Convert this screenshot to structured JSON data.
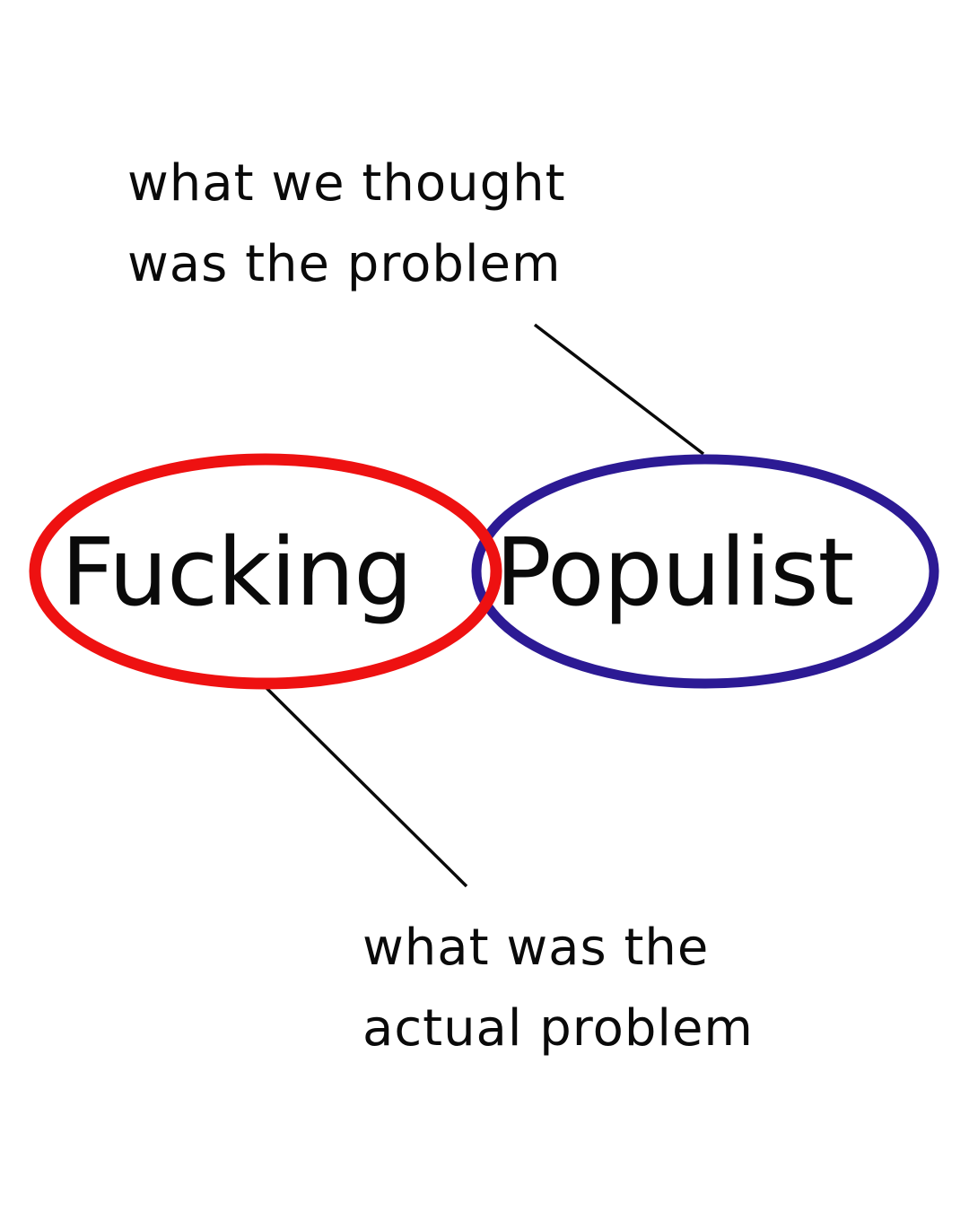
{
  "annotations": {
    "top": {
      "line1": "what we thought",
      "line2": "was the problem"
    },
    "bottom": {
      "line1": "what was the",
      "line2": "actual problem"
    }
  },
  "words": {
    "left": "Fucking",
    "right": "Populist"
  },
  "colors": {
    "left_ring": "#ee1111",
    "right_ring": "#2c1a94",
    "connector": "#0a0a0a",
    "text": "#0a0a0a",
    "background": "#ffffff"
  }
}
